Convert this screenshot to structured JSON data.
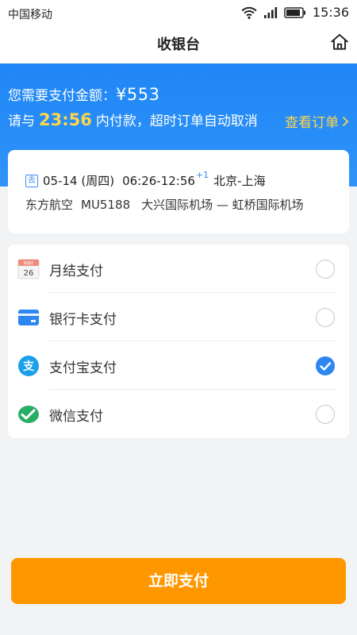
{
  "status_bar": {
    "carrier": "中国移动",
    "time": "15:36"
  },
  "nav": {
    "title": "收银台",
    "home_icon": "home-icon"
  },
  "banner": {
    "amount_prefix": "您需要支付金额：",
    "amount": "¥553",
    "timer_prefix": "请与",
    "timer": "23:56",
    "timer_suffix": "内付款，超时订单自动取消",
    "view_order": "查看订单"
  },
  "flight": {
    "tag": "去",
    "date": "05-14 (周四)",
    "time_range": "06:26-12:56",
    "plus_day": "+1",
    "route": "北京-上海",
    "airline": "东方航空",
    "flight_no": "MU5188",
    "airports": "大兴国际机场 — 虹桥国际机场"
  },
  "payment_methods": [
    {
      "label": "月结支付",
      "icon": "calendar-icon",
      "selected": false
    },
    {
      "label": "银行卡支付",
      "icon": "bank-card-icon",
      "selected": false
    },
    {
      "label": "支付宝支付",
      "icon": "alipay-icon",
      "selected": true
    },
    {
      "label": "微信支付",
      "icon": "wechat-icon",
      "selected": false
    }
  ],
  "calendar_icon": {
    "month": "MAY",
    "day": "26"
  },
  "alipay_icon_glyph": "支",
  "pay_button": "立即支付",
  "colors": {
    "primary": "#2e86f1",
    "accent": "#ff9800",
    "highlight": "#ffd54a"
  }
}
